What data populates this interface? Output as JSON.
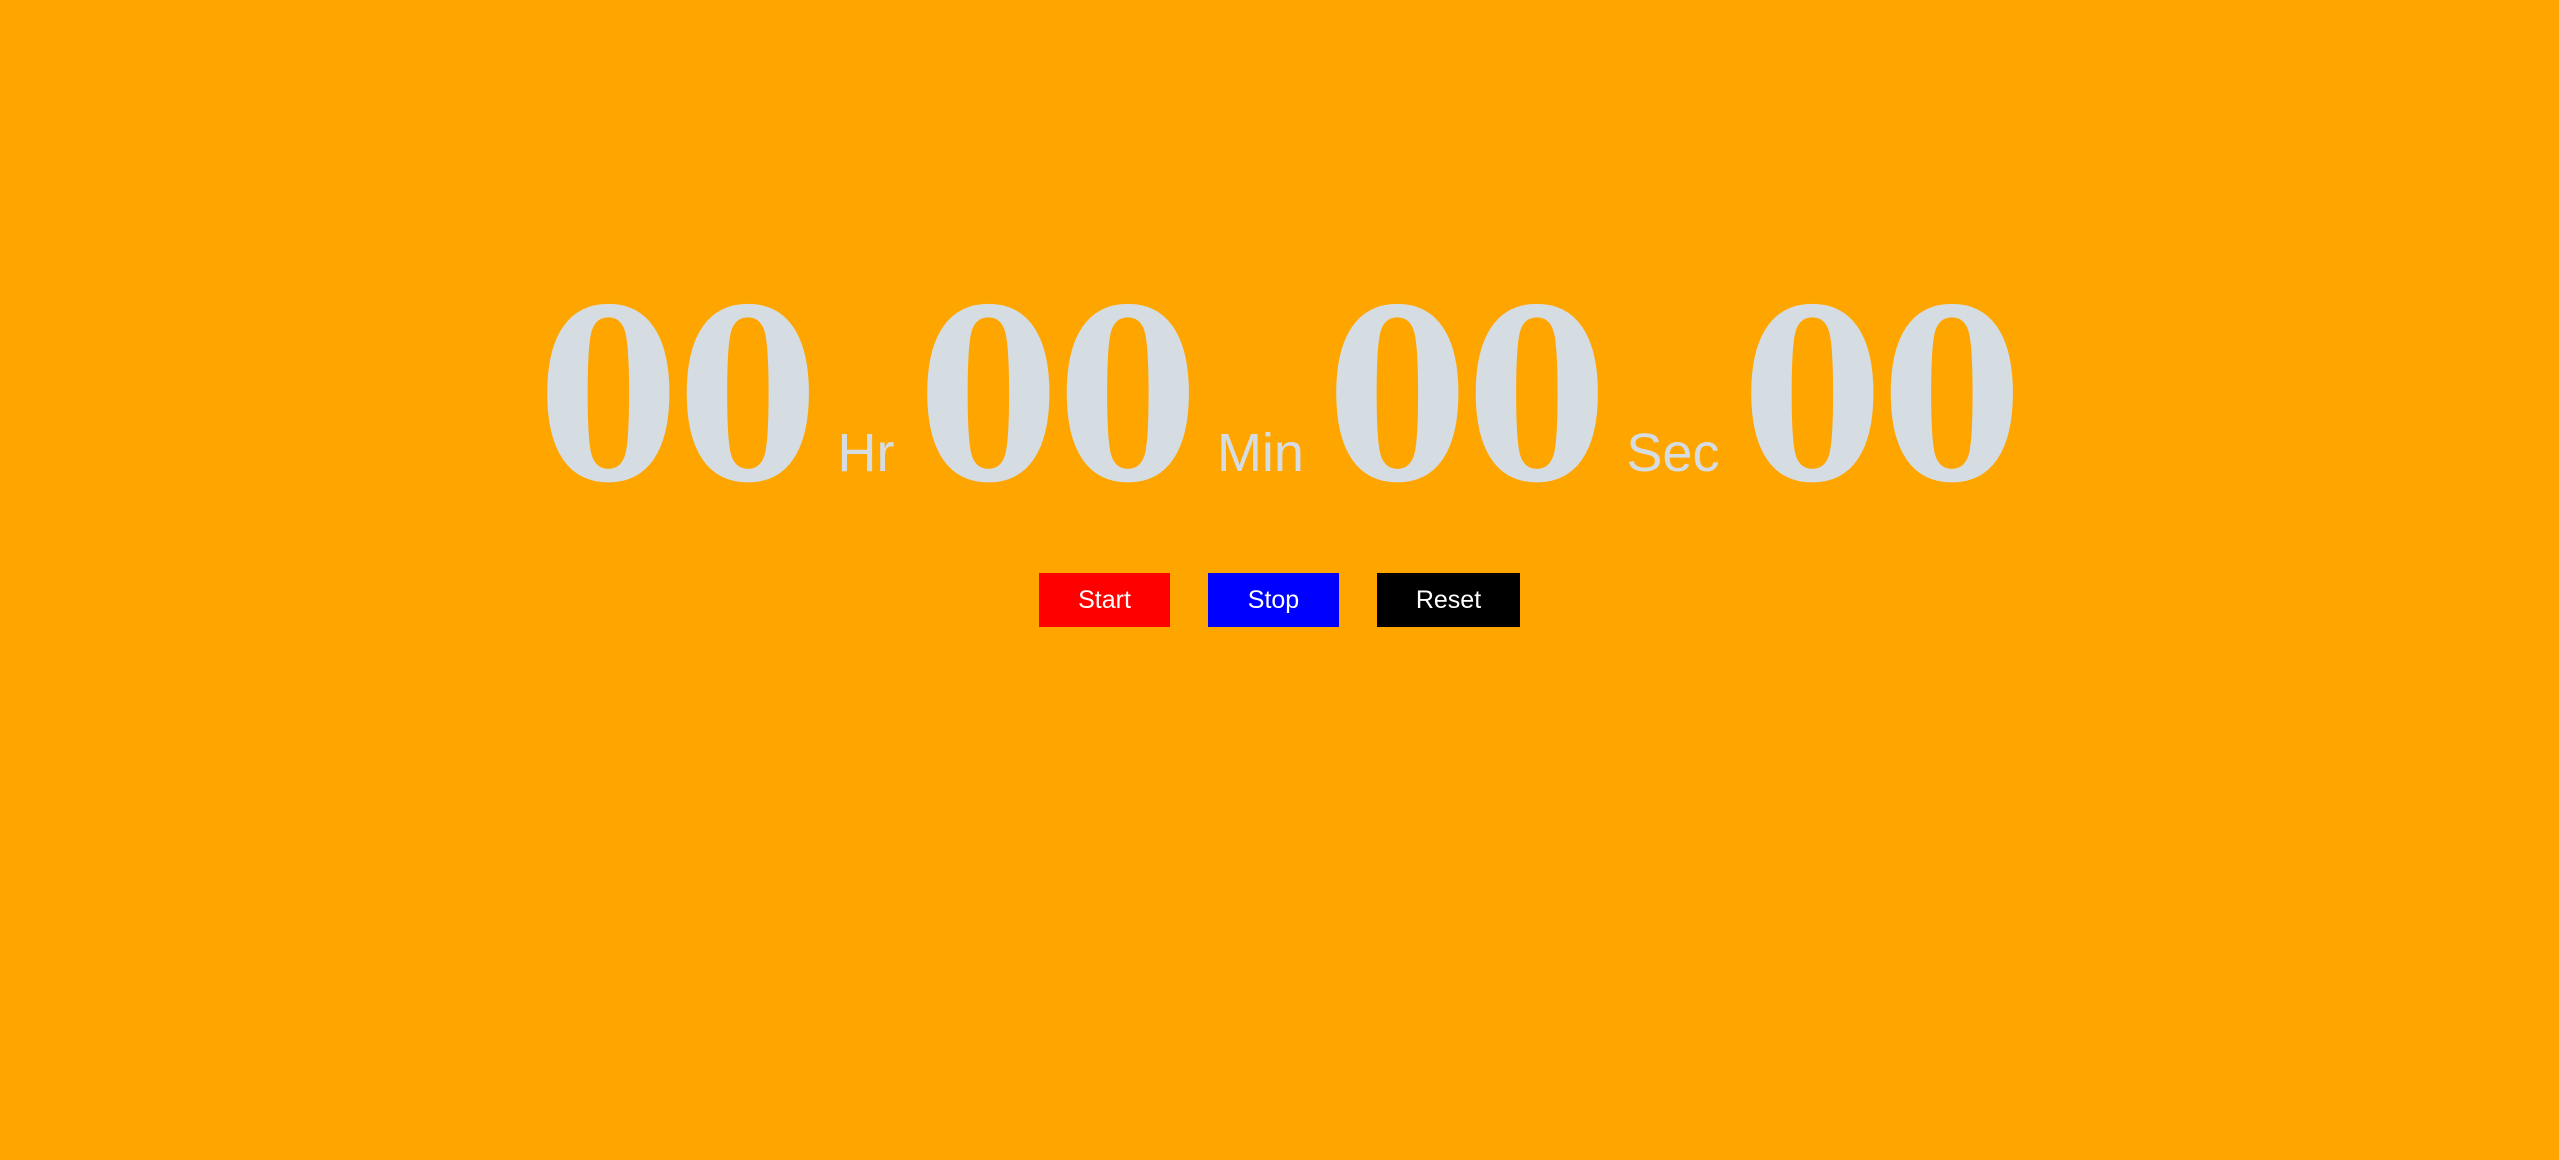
{
  "colors": {
    "background": "#FFA500",
    "digit_color": "#D5DDE3",
    "button_text": "#FFFFFF",
    "start_bg": "#FF0000",
    "stop_bg": "#0000FF",
    "reset_bg": "#000000"
  },
  "timer": {
    "hours": "00",
    "hours_unit": "Hr",
    "minutes": "00",
    "minutes_unit": "Min",
    "seconds": "00",
    "seconds_unit": "Sec",
    "centiseconds": "00"
  },
  "controls": {
    "start_label": "Start",
    "stop_label": "Stop",
    "reset_label": "Reset"
  }
}
